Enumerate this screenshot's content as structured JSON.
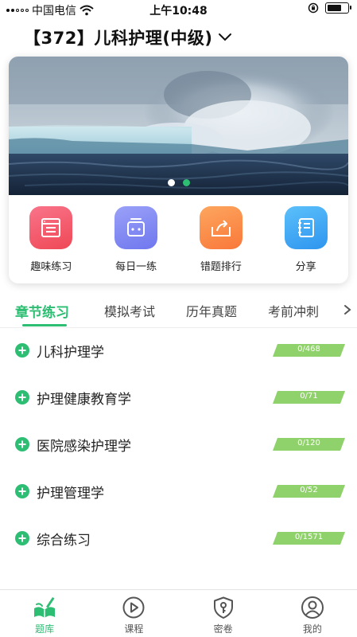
{
  "status_bar": {
    "carrier": "中国电信",
    "time": "上午10:48",
    "battery_level": 0.75,
    "icons": [
      "signal-icon",
      "wifi-icon",
      "orientation-lock-icon",
      "battery-icon"
    ]
  },
  "header": {
    "title": "【372】儿科护理(中级)",
    "dropdown_icon": "chevron-down-icon"
  },
  "banner": {
    "image": "ocean-wave-photo",
    "slide_count": 2,
    "active_slide": 2
  },
  "shortcuts": [
    {
      "label": "趣味练习",
      "icon": "quiz-list-icon",
      "color": "#f25563"
    },
    {
      "label": "每日一练",
      "icon": "daily-box-icon",
      "color": "#7f87f3"
    },
    {
      "label": "错题排行",
      "icon": "ranking-share-icon",
      "color": "#fb8745"
    },
    {
      "label": "分享",
      "icon": "notebook-icon",
      "color": "#3fa9f5"
    }
  ],
  "tabs": [
    {
      "label": "章节练习",
      "active": true
    },
    {
      "label": "模拟考试",
      "active": false
    },
    {
      "label": "历年真题",
      "active": false
    },
    {
      "label": "考前冲刺",
      "active": false
    }
  ],
  "chapters": [
    {
      "name": "儿科护理学",
      "progress": "0/468"
    },
    {
      "name": "护理健康教育学",
      "progress": "0/71"
    },
    {
      "name": "医院感染护理学",
      "progress": "0/120"
    },
    {
      "name": "护理管理学",
      "progress": "0/52"
    },
    {
      "name": "综合练习",
      "progress": "0/1571"
    }
  ],
  "bottom_nav": [
    {
      "label": "题库",
      "icon": "book-pen-icon",
      "active": true
    },
    {
      "label": "课程",
      "icon": "play-circle-icon",
      "active": false
    },
    {
      "label": "密卷",
      "icon": "shield-key-icon",
      "active": false
    },
    {
      "label": "我的",
      "icon": "user-circle-icon",
      "active": false
    }
  ],
  "colors": {
    "accent": "#2dbd73",
    "progress_badge": "#8fd16a"
  }
}
